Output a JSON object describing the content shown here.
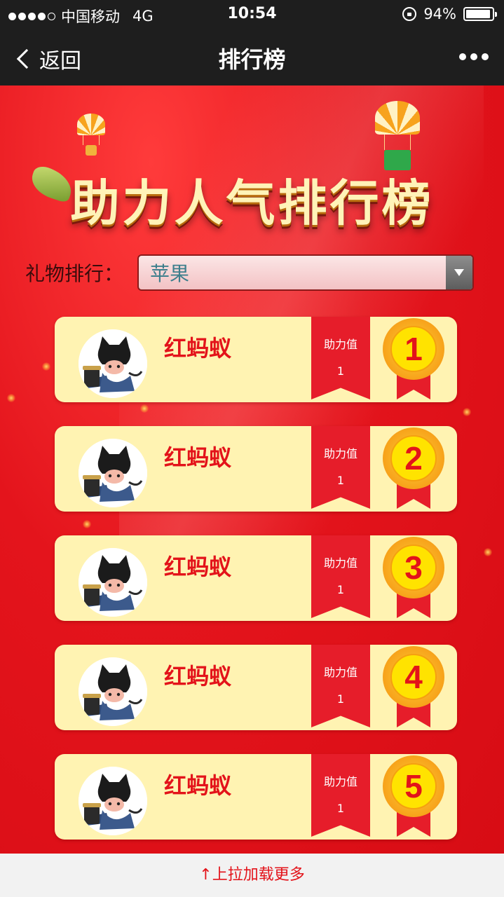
{
  "status_bar": {
    "carrier": "中国移动",
    "network": "4G",
    "time": "10:54",
    "battery": "94%",
    "battery_level": 0.94
  },
  "nav": {
    "back_label": "返回",
    "title": "排行榜",
    "more_icon": "more-dots-icon"
  },
  "banner": {
    "title": "助力人气排行榜"
  },
  "filter": {
    "label": "礼物排行：",
    "selected": "苹果"
  },
  "ranking": {
    "items": [
      {
        "rank": "1",
        "name": "红蚂蚁",
        "score_label": "助力值",
        "score": "1"
      },
      {
        "rank": "2",
        "name": "红蚂蚁",
        "score_label": "助力值",
        "score": "1"
      },
      {
        "rank": "3",
        "name": "红蚂蚁",
        "score_label": "助力值",
        "score": "1"
      },
      {
        "rank": "4",
        "name": "红蚂蚁",
        "score_label": "助力值",
        "score": "1"
      },
      {
        "rank": "5",
        "name": "红蚂蚁",
        "score_label": "助力值",
        "score": "1"
      }
    ]
  },
  "footer": {
    "load_more": "↑上拉加载更多"
  },
  "colors": {
    "accent": "#e3131a",
    "card_bg": "#fff3b2",
    "medal": "#ffe300",
    "page_bg": "#e4141c"
  }
}
